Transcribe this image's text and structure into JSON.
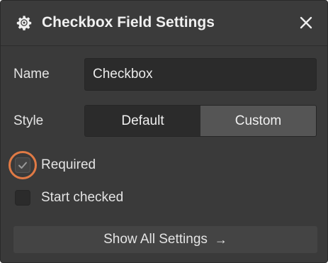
{
  "header": {
    "title": "Checkbox Field Settings",
    "settings_icon": "gear-icon",
    "close_icon": "close-icon"
  },
  "fields": {
    "name_label": "Name",
    "name_value": "Checkbox",
    "style_label": "Style",
    "style_options": [
      "Default",
      "Custom"
    ],
    "style_selected": "Default"
  },
  "options": {
    "required_label": "Required",
    "required_checked": true,
    "start_checked_label": "Start checked",
    "start_checked_checked": false
  },
  "footer": {
    "show_all_label": "Show All Settings",
    "arrow": "→"
  },
  "colors": {
    "panel_bg": "#3a3a3a",
    "input_bg": "#2b2b2b",
    "highlight_ring": "#e07a45"
  }
}
